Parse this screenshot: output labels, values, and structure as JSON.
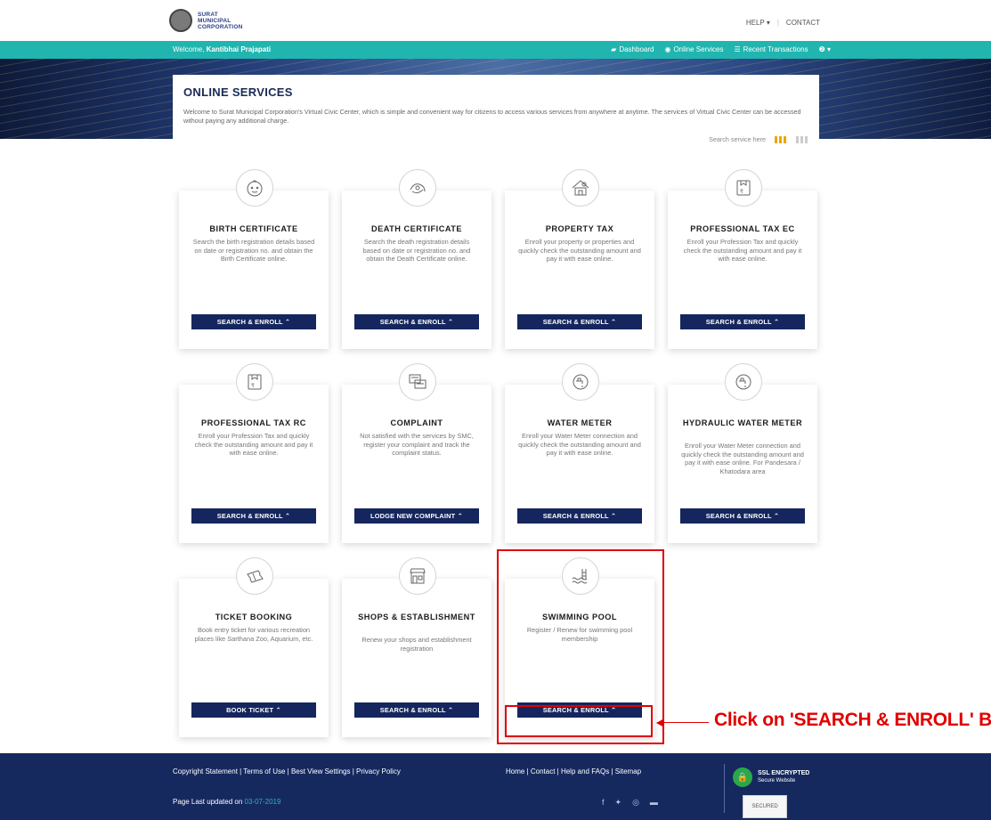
{
  "header": {
    "logo_line1": "SURAT",
    "logo_line2": "MUNICIPAL",
    "logo_line3": "CORPORATION",
    "help": "HELP ▾",
    "contact": "CONTACT"
  },
  "navbar": {
    "welcome_prefix": "Welcome,",
    "user_name": "Kantibhai Prajapati",
    "links": [
      "Dashboard",
      "Online Services",
      "Recent Transactions"
    ],
    "profile": "❷ ▾"
  },
  "intro": {
    "title": "ONLINE SERVICES",
    "text": "Welcome to Surat Municipal Corporation's Virtual Civic Center, which is simple and convenient way for citizens to access various services from anywhere at anytime. The services of Virtual Civic Center can be accessed without paying any additional charge.",
    "search_label": "Search service here"
  },
  "cards": [
    {
      "title": "BIRTH CERTIFICATE",
      "desc": "Search the birth registration details based on date or registration no. and obtain the Birth Certificate online.",
      "button": "SEARCH & ENROLL ⌃",
      "icon": "baby-icon"
    },
    {
      "title": "DEATH CERTIFICATE",
      "desc": "Search the death registration details based on date or registration no. and obtain the Death Certificate online.",
      "button": "SEARCH & ENROLL ⌃",
      "icon": "death-certificate-icon"
    },
    {
      "title": "PROPERTY TAX",
      "desc": "Enroll your property or properties and quickly check the outstanding amount and pay it with ease online.",
      "button": "SEARCH & ENROLL ⌃",
      "icon": "house-icon"
    },
    {
      "title": "PROFESSIONAL TAX EC",
      "desc": "Enroll your Profession Tax and quickly check the outstanding amount and pay it with ease online.",
      "button": "SEARCH & ENROLL ⌃",
      "icon": "professional-tax-icon"
    },
    {
      "title": "PROFESSIONAL TAX RC",
      "desc": "Enroll your Profession Tax and quickly check the outstanding amount and pay it with ease online.",
      "button": "SEARCH & ENROLL ⌃",
      "icon": "professional-tax-icon"
    },
    {
      "title": "COMPLAINT",
      "desc": "Not satisfied with the services by SMC, register your complaint and track the complaint status.",
      "button": "LODGE NEW COMPLAINT ⌃",
      "icon": "complaint-icon"
    },
    {
      "title": "WATER METER",
      "desc": "Enroll your Water Meter connection and quickly check the outstanding amount and pay it with ease online.",
      "button": "SEARCH & ENROLL ⌃",
      "icon": "water-tap-icon"
    },
    {
      "title": "HYDRAULIC WATER METER",
      "desc": "Enroll your Water Meter connection and quickly check the outstanding amount and pay it with ease online. For Pandesara / Khatodara area",
      "button": "SEARCH & ENROLL ⌃",
      "icon": "water-tap-icon"
    },
    {
      "title": "TICKET BOOKING",
      "desc": "Book entry ticket for various recreation places like Sarthana Zoo, Aquarium, etc.",
      "button": "BOOK TICKET ⌃",
      "icon": "ticket-icon"
    },
    {
      "title": "SHOPS & ESTABLISHMENT",
      "desc": "Renew your shops and establishment registration",
      "button": "SEARCH & ENROLL ⌃",
      "icon": "shop-icon"
    },
    {
      "title": "SWIMMING POOL",
      "desc": "Register / Renew for swimming pool membership",
      "button": "SEARCH & ENROLL ⌃",
      "icon": "swimming-pool-icon"
    }
  ],
  "annotation": {
    "label": "Click on 'SEARCH & ENROLL' B"
  },
  "footer": {
    "links": "Copyright Statement | Terms of Use | Best View Settings | Privacy Policy",
    "midlinks": "Home | Contact | Help and FAQs | Sitemap",
    "updated_prefix": "Page Last updated on",
    "updated_date": "03-07-2019",
    "ssl_title": "SSL ENCRYPTED",
    "ssl_sub": "Secure Website",
    "secured": "SECURED"
  },
  "colors": {
    "navbar": "#21b5b0",
    "button": "#15265e",
    "footer": "#16295f",
    "highlight": "#e00000"
  }
}
